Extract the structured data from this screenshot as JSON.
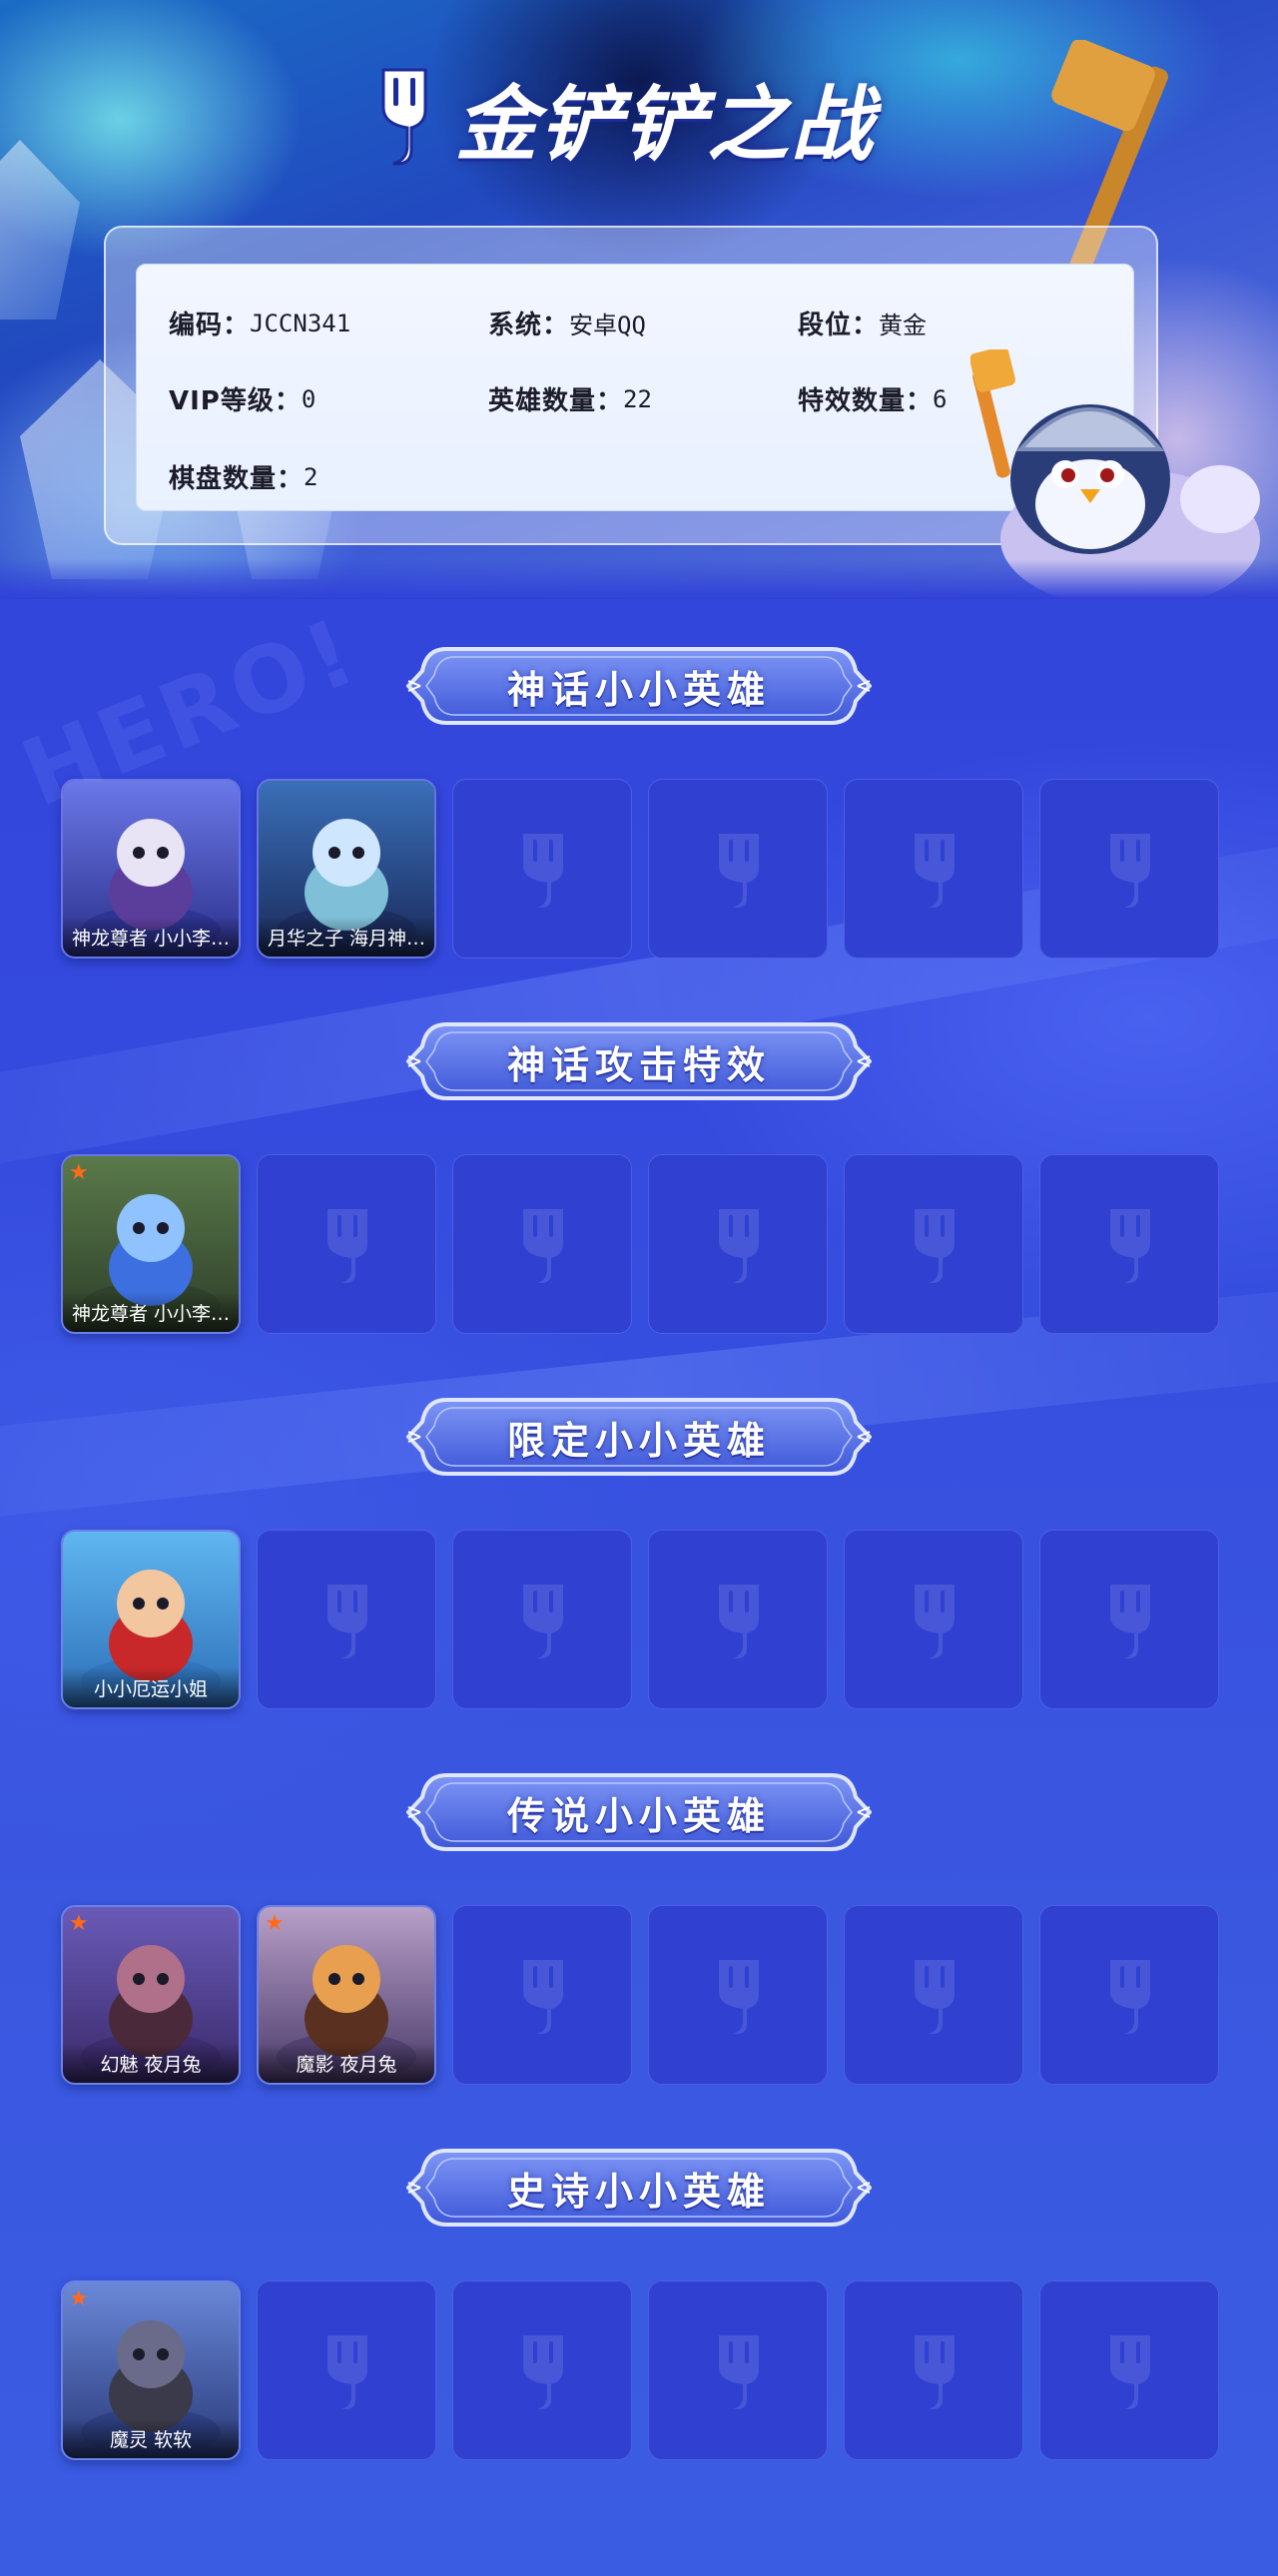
{
  "app": {
    "title": "金铲铲之战"
  },
  "info": {
    "code_label": "编码：",
    "code_value": "JCCN341",
    "system_label": "系统：",
    "system_value": "安卓QQ",
    "rank_label": "段位：",
    "rank_value": "黄金",
    "vip_label": "VIP等级：",
    "vip_value": "0",
    "hero_count_label": "英雄数量：",
    "hero_count_value": "22",
    "effect_count_label": "特效数量：",
    "effect_count_value": "6",
    "board_count_label": "棋盘数量：",
    "board_count_value": "2"
  },
  "watermark": "HERO!",
  "sections": [
    {
      "title": "神话小小英雄",
      "items": [
        {
          "name": "神龙尊者 小小李…",
          "starred": false
        },
        {
          "name": "月华之子 海月神…",
          "starred": false
        }
      ]
    },
    {
      "title": "神话攻击特效",
      "items": [
        {
          "name": "神龙尊者 小小李…",
          "starred": true
        }
      ]
    },
    {
      "title": "限定小小英雄",
      "items": [
        {
          "name": "小小厄运小姐",
          "starred": false
        }
      ]
    },
    {
      "title": "传说小小英雄",
      "items": [
        {
          "name": "幻魅 夜月兔",
          "starred": true
        },
        {
          "name": "魔影 夜月兔",
          "starred": true
        }
      ]
    },
    {
      "title": "史诗小小英雄",
      "items": [
        {
          "name": "魔灵 软软",
          "starred": true
        }
      ]
    }
  ],
  "star_glyph": "★",
  "colors": {
    "star": "#ff6a1c",
    "empty_slot": "#3040d0",
    "page_bg": "#3345db"
  }
}
